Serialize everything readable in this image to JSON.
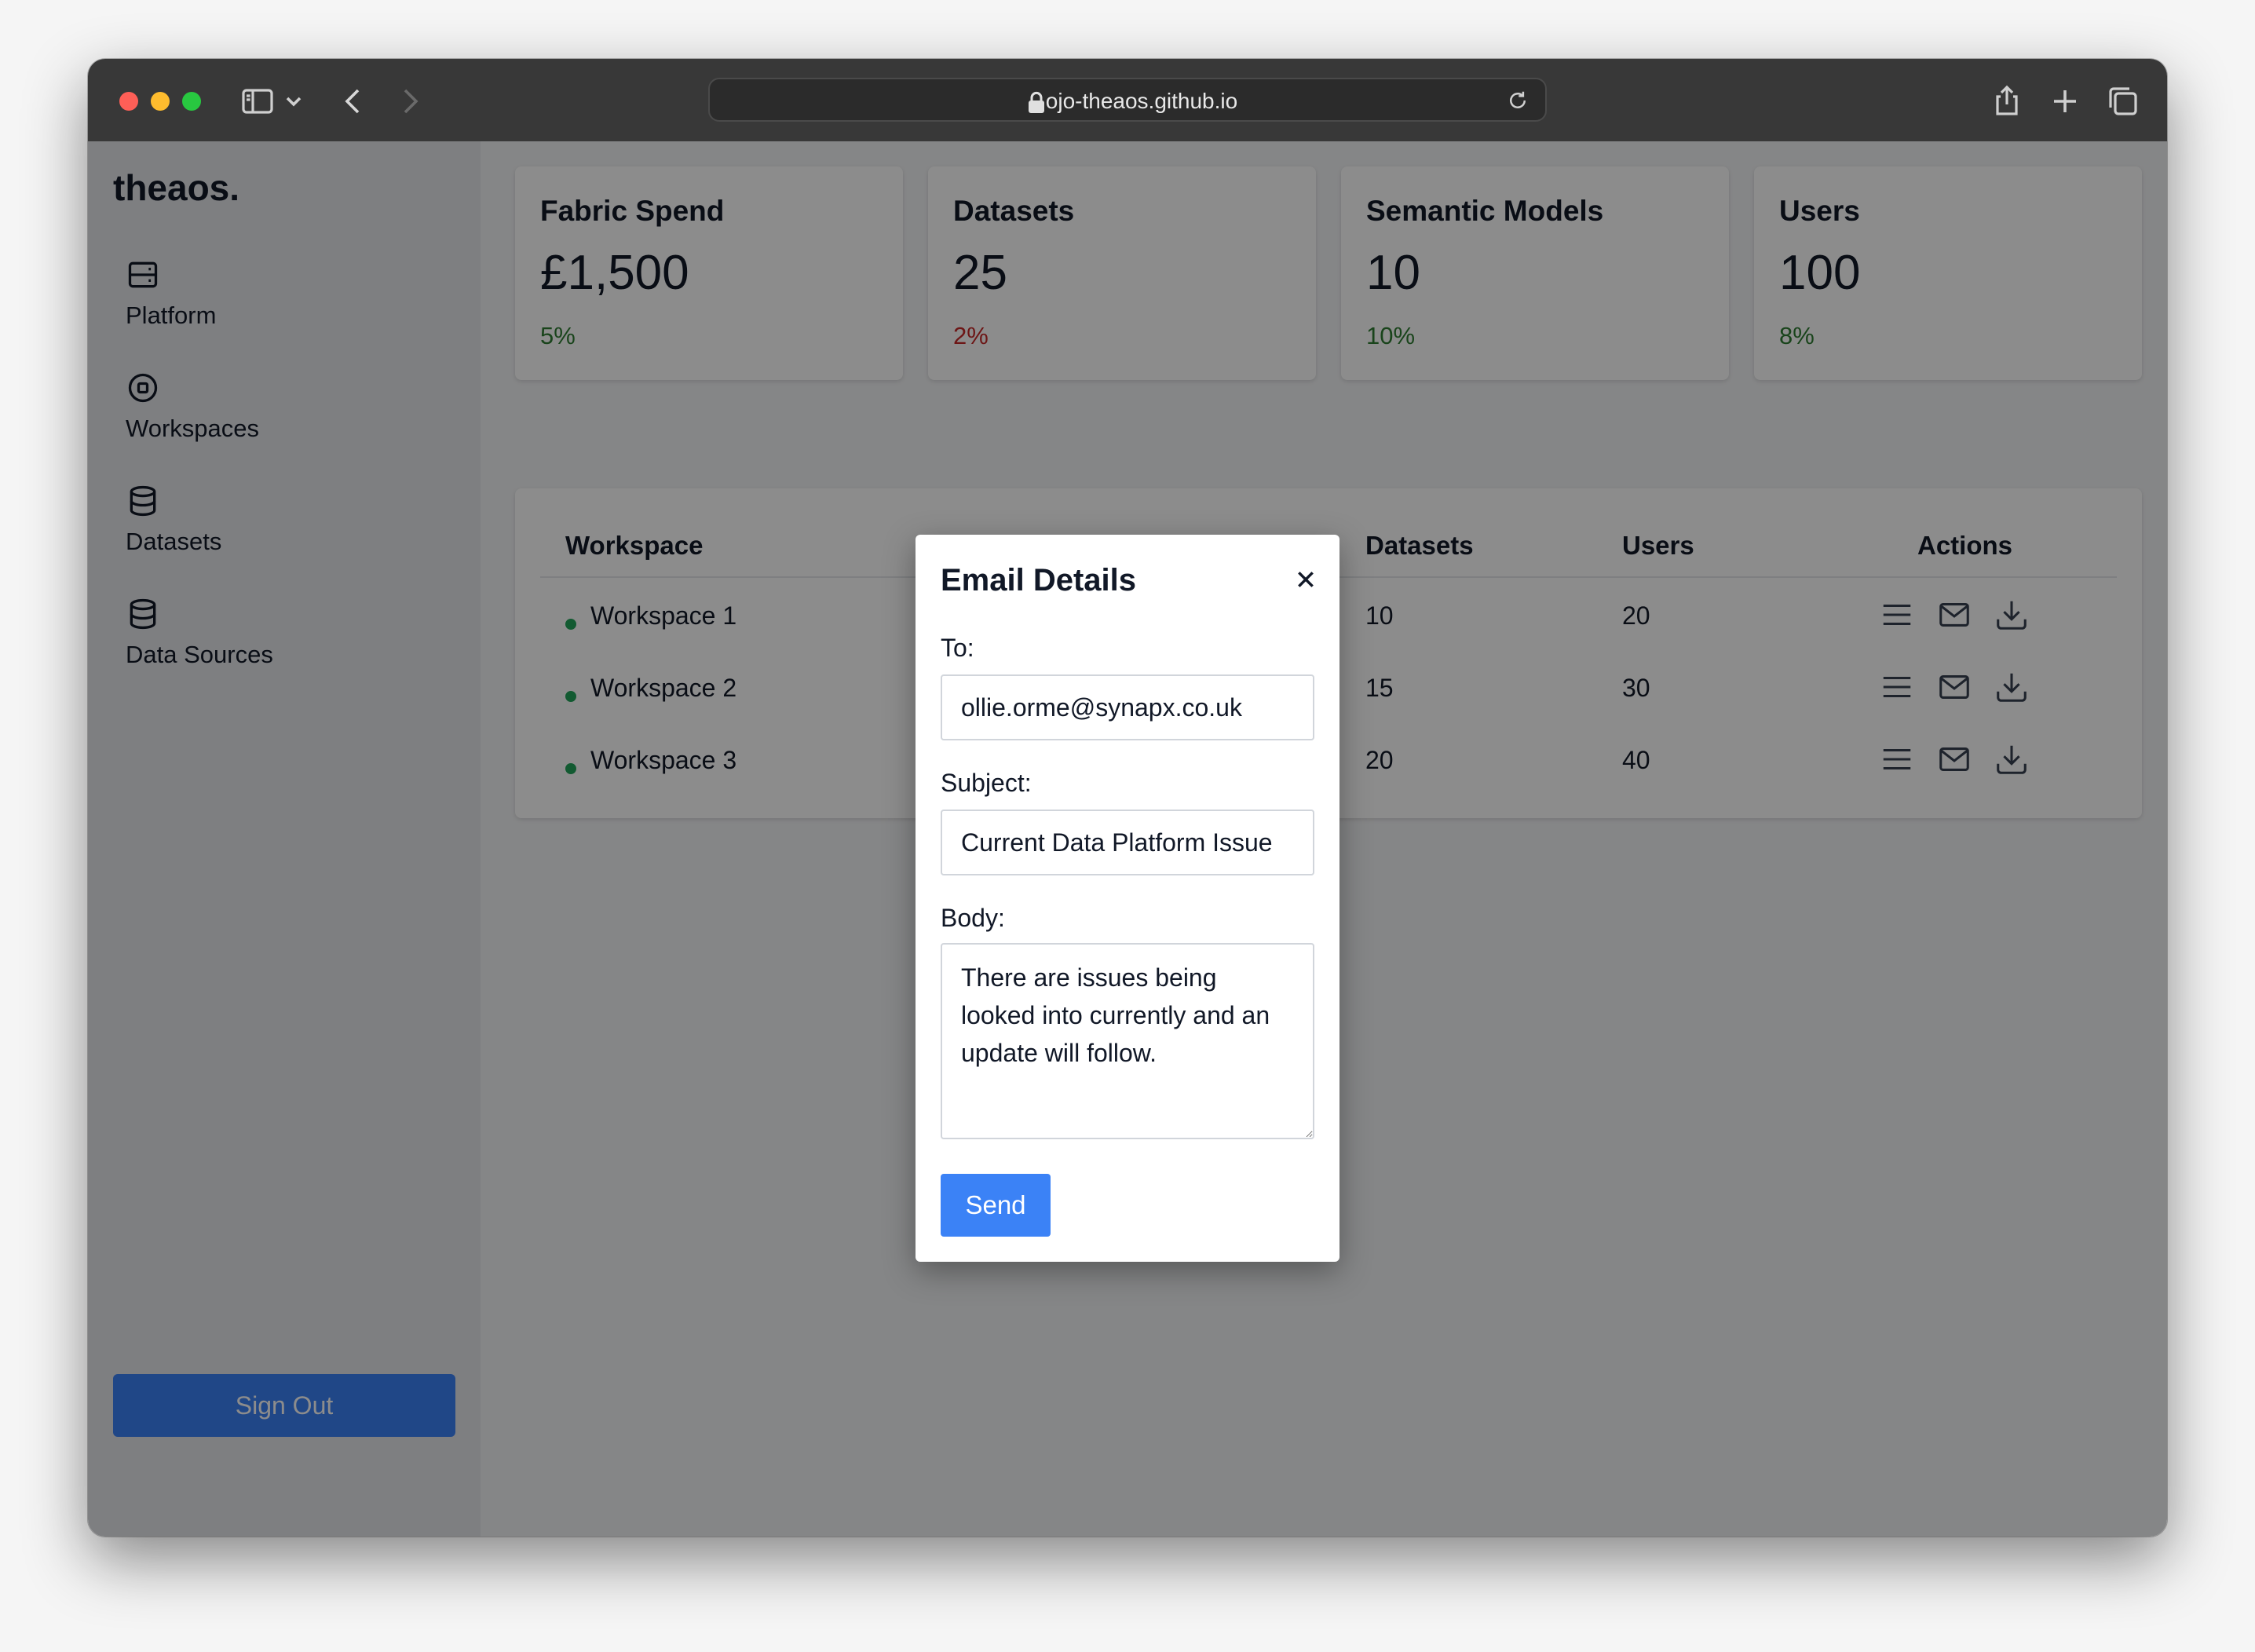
{
  "browser": {
    "url": "ojo-theaos.github.io"
  },
  "sidebar": {
    "logo": "theaos.",
    "items": [
      {
        "label": "Platform",
        "icon": "server-icon"
      },
      {
        "label": "Workspaces",
        "icon": "target-icon"
      },
      {
        "label": "Datasets",
        "icon": "database-icon"
      },
      {
        "label": "Data Sources",
        "icon": "database-icon"
      }
    ],
    "signout_label": "Sign Out"
  },
  "stats": [
    {
      "title": "Fabric Spend",
      "value": "£1,500",
      "change": "5%",
      "trend_color": "#2e7d32"
    },
    {
      "title": "Datasets",
      "value": "25",
      "change": "2%",
      "trend_color": "#c62828"
    },
    {
      "title": "Semantic Models",
      "value": "10",
      "change": "10%",
      "trend_color": "#2e7d32"
    },
    {
      "title": "Users",
      "value": "100",
      "change": "8%",
      "trend_color": "#2e7d32"
    }
  ],
  "table": {
    "headers": {
      "workspace": "Workspace",
      "datasets": "Datasets",
      "users": "Users",
      "actions": "Actions"
    },
    "rows": [
      {
        "workspace": "Workspace 1",
        "datasets": "10",
        "users": "20",
        "status_color": "#22a55a"
      },
      {
        "workspace": "Workspace 2",
        "datasets": "15",
        "users": "30",
        "status_color": "#22a55a"
      },
      {
        "workspace": "Workspace 3",
        "datasets": "20",
        "users": "40",
        "status_color": "#22a55a"
      }
    ],
    "action_icons": [
      "menu-icon",
      "mail-icon",
      "download-icon"
    ]
  },
  "modal": {
    "title": "Email Details",
    "close_symbol": "×",
    "to_label": "To:",
    "to_value": "ollie.orme@synapx.co.uk",
    "subject_label": "Subject:",
    "subject_value": "Current Data Platform Issue",
    "body_label": "Body:",
    "body_value": "There are issues being looked into currently and an update will follow.",
    "send_label": "Send"
  },
  "colors": {
    "accent": "#3b82f6",
    "positive": "#2e7d32",
    "negative": "#c62828"
  }
}
